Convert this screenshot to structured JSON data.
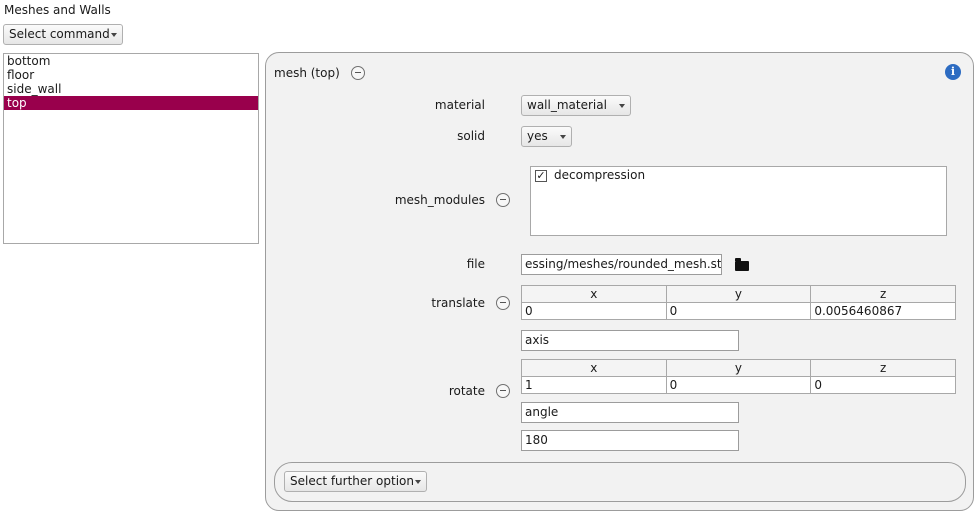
{
  "page": {
    "title": "Meshes and Walls"
  },
  "command_menu": {
    "label": "Select command"
  },
  "mesh_list": [
    {
      "label": "bottom",
      "selected": false
    },
    {
      "label": "floor",
      "selected": false
    },
    {
      "label": "side_wall",
      "selected": false
    },
    {
      "label": "top",
      "selected": true
    }
  ],
  "panel": {
    "title": "mesh (top)",
    "material": {
      "label": "material",
      "value": "wall_material"
    },
    "solid": {
      "label": "solid",
      "value": "yes"
    },
    "mesh_modules": {
      "label": "mesh_modules",
      "items": [
        {
          "label": "decompression",
          "checked": true
        }
      ]
    },
    "file": {
      "label": "file",
      "value": "essing/meshes/rounded_mesh.stl"
    },
    "translate": {
      "label": "translate",
      "headers": [
        "x",
        "y",
        "z"
      ],
      "values": [
        "0",
        "0",
        "0.0056460867"
      ]
    },
    "rotate": {
      "label": "rotate",
      "axis_label": "axis",
      "headers": [
        "x",
        "y",
        "z"
      ],
      "values": [
        "1",
        "0",
        "0"
      ],
      "angle_label": "angle",
      "angle_value": "180"
    },
    "further_option": {
      "label": "Select further option"
    }
  },
  "colors": {
    "selection": "#99004c",
    "info": "#2d6cc2"
  },
  "icons": [
    "minus-circle-icon",
    "info-icon",
    "folder-icon",
    "dropdown-arrow-icon",
    "checkmark-icon"
  ]
}
